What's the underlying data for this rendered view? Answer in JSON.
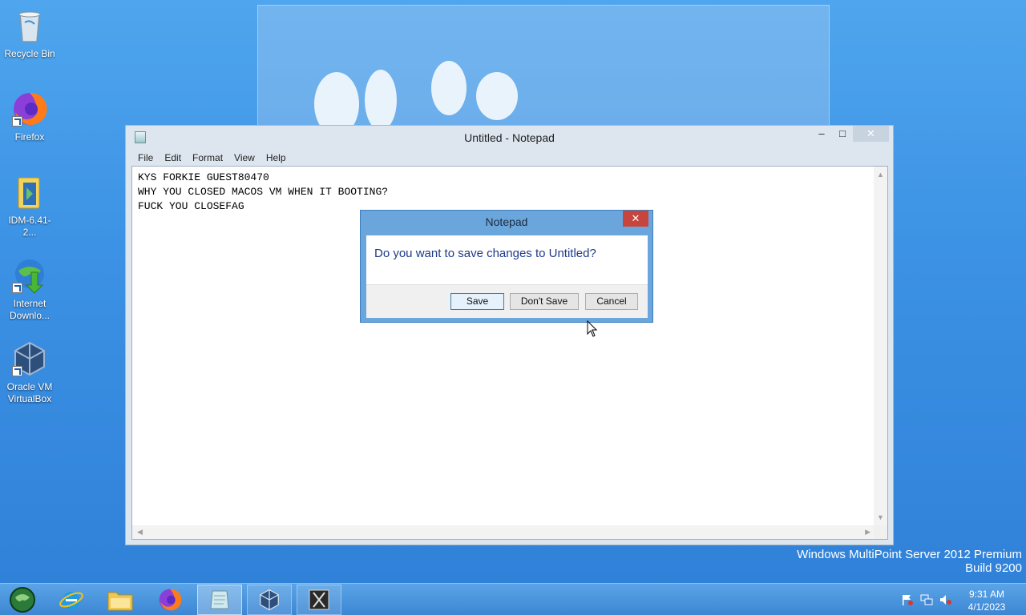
{
  "desktop": {
    "icons": [
      {
        "label": "Recycle Bin"
      },
      {
        "label": "Firefox"
      },
      {
        "label": "IDM-6.41-2..."
      },
      {
        "label": "Internet Downlo..."
      },
      {
        "label": "Oracle VM VirtualBox"
      }
    ]
  },
  "notepad": {
    "title": "Untitled - Notepad",
    "menu": [
      "File",
      "Edit",
      "Format",
      "View",
      "Help"
    ],
    "content_lines": [
      "KYS FORKIE GUEST80470",
      "WHY YOU CLOSED MACOS VM WHEN IT BOOTING?",
      "FUCK YOU CLOSEFAG"
    ]
  },
  "dialog": {
    "title": "Notepad",
    "message": "Do you want to save changes to Untitled?",
    "buttons": {
      "save": "Save",
      "dont_save": "Don't Save",
      "cancel": "Cancel"
    }
  },
  "watermark": {
    "line1": "Windows MultiPoint Server 2012 Premium",
    "line2": "Build 9200"
  },
  "taskbar": {
    "items": [
      "start-orb",
      "internet-explorer",
      "file-explorer",
      "firefox",
      "notepad",
      "virtualbox",
      "macos-vm"
    ],
    "clock": {
      "time": "9:31 AM",
      "date": "4/1/2023"
    }
  },
  "colors": {
    "desktop": "#3c92e4",
    "dialog_frame": "#6aa6dc",
    "close_red": "#c7453d",
    "message_text": "#1e3a8a"
  }
}
